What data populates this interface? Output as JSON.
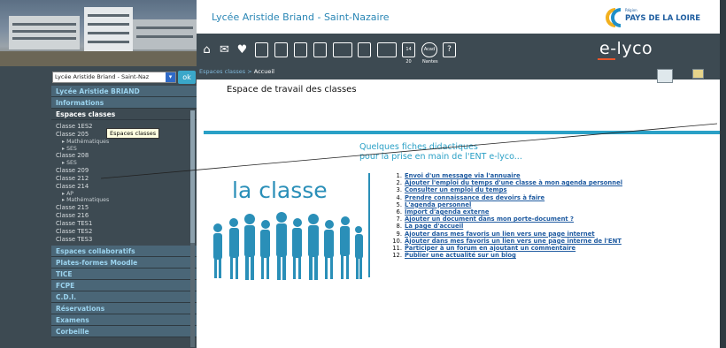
{
  "header": {
    "title": "Lycée Aristide Briand - Saint-Nazaire",
    "region_small": "Région",
    "region_name": "PAYS DE LA LOIRE",
    "brand": "e-lyco"
  },
  "toolbar": {
    "icons": [
      "home-icon",
      "envelope-icon",
      "notes-heart-icon",
      "printer-icon",
      "notebook-icon",
      "calendar-icon",
      "book-icon",
      "document-icon",
      "briefcase-icon",
      "news-icon",
      "calendar-day-icon",
      "academic-icon",
      "help-icon"
    ],
    "calendar_day": "14\n20",
    "acad_label": "Acad\nNantes",
    "help_label": "?"
  },
  "school_select": {
    "value": "Lycée Aristide Briand - Saint-Naz",
    "ok_label": "ok"
  },
  "breadcrumb": {
    "parent": "Espaces classes",
    "separator": " > ",
    "current": "Accueil"
  },
  "sidebar": {
    "school": "Lycée Aristide BRIAND",
    "informations": "Informations",
    "espaces_classes": "Espaces classes",
    "classes": [
      {
        "label": "Classe 1ES2",
        "subs": []
      },
      {
        "label": "Classe 205",
        "subs": [
          "Mathématiques",
          "SES"
        ]
      },
      {
        "label": "Classe 208",
        "subs": [
          "SES"
        ]
      },
      {
        "label": "Classe 209",
        "subs": []
      },
      {
        "label": "Classe 212",
        "subs": []
      },
      {
        "label": "Classe 214",
        "subs": [
          "AP",
          "Mathématiques"
        ]
      },
      {
        "label": "Classe 215",
        "subs": []
      },
      {
        "label": "Classe 216",
        "subs": []
      },
      {
        "label": "Classe TES1",
        "subs": []
      },
      {
        "label": "Classe TES2",
        "subs": []
      },
      {
        "label": "Classe TES3",
        "subs": []
      }
    ],
    "sections": [
      "Espaces collaboratifs",
      "Plates-formes Moodle",
      "TICE",
      "FCPE",
      "C.D.I.",
      "Réservations",
      "Examens",
      "Corbeille"
    ],
    "tooltip": "Espaces classes"
  },
  "main": {
    "title": "Espace de travail des classes",
    "fiches_line1": "Quelques fiches didactiques",
    "fiches_line2": "pour la prise en main de l'ENT e-lyco...",
    "la_classe": "la classe",
    "items": [
      "Envoi d'un message via l'annuaire",
      "Ajouter l'emploi du temps d'une classe à mon agenda personnel",
      "Consulter un emploi du temps",
      "Prendre connaissance des devoirs à faire",
      "L'agenda personnel",
      "Import d'agenda externe",
      "Ajouter un document dans mon porte-document ?",
      "La page d'accueil",
      "Ajouter dans mes favoris un lien vers une page internet",
      "Ajouter dans mes favoris un lien vers une page interne de l'ENT",
      "Participer à un forum en ajoutant un commentaire",
      "Publier une actualité sur un blog"
    ]
  },
  "colors": {
    "sidebar_bg": "#3d4a52",
    "accent": "#2aa0c6",
    "link": "#1e5aa0",
    "brand_blue": "#2a86b5"
  }
}
